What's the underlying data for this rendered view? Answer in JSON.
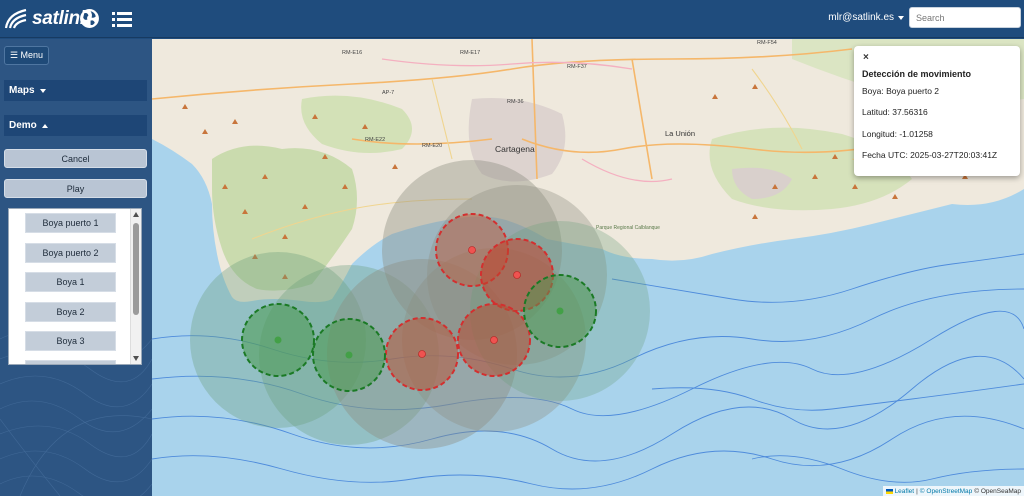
{
  "header": {
    "brand": "satlink",
    "user": "mlr@satlink.es",
    "search_placeholder": "Search"
  },
  "sidebar": {
    "menu_label": "☰ Menu",
    "sections": [
      {
        "label": "Maps",
        "expanded": false
      },
      {
        "label": "Demo",
        "expanded": true
      }
    ],
    "cancel_label": "Cancel",
    "play_label": "Play",
    "items": [
      "Boya puerto 1",
      "Boya puerto 2",
      "Boya 1",
      "Boya 2",
      "Boya 3"
    ]
  },
  "map": {
    "city_label": "Cartagena",
    "place_labels": [
      "La Unión",
      "RM-E16",
      "RM-E17",
      "AP-7",
      "RM-36",
      "RM-F37",
      "RM-E22",
      "RM-E20",
      "RM-F54"
    ],
    "park_label": "Parque Regional Calblanque",
    "markers": [
      {
        "status": "alert",
        "color": "#e53935"
      },
      {
        "status": "alert",
        "color": "#e53935"
      },
      {
        "status": "alert",
        "color": "#e53935"
      },
      {
        "status": "alert",
        "color": "#e53935"
      },
      {
        "status": "ok",
        "color": "#2e9e3c"
      },
      {
        "status": "ok",
        "color": "#2e9e3c"
      },
      {
        "status": "ok",
        "color": "#2e9e3c"
      }
    ]
  },
  "popup": {
    "close": "×",
    "title": "Detección de movimiento",
    "boya": "Boya: Boya puerto 2",
    "latitud": "Latitud: 37.56316",
    "longitud": "Longitud: -1.01258",
    "fecha": "Fecha UTC: 2025-03-27T20:03:41Z"
  },
  "attribution": {
    "leaflet": "Leaflet",
    "sep1": "|",
    "osm": "© OpenStreetMap",
    "seamap": "© OpenSeaMap"
  },
  "colors": {
    "header_bg": "#1f4c7d",
    "sidebar_bg": "#2d5583",
    "alert": "#e53935",
    "ok": "#2e9e3c",
    "sea": "#a9d3ec"
  }
}
